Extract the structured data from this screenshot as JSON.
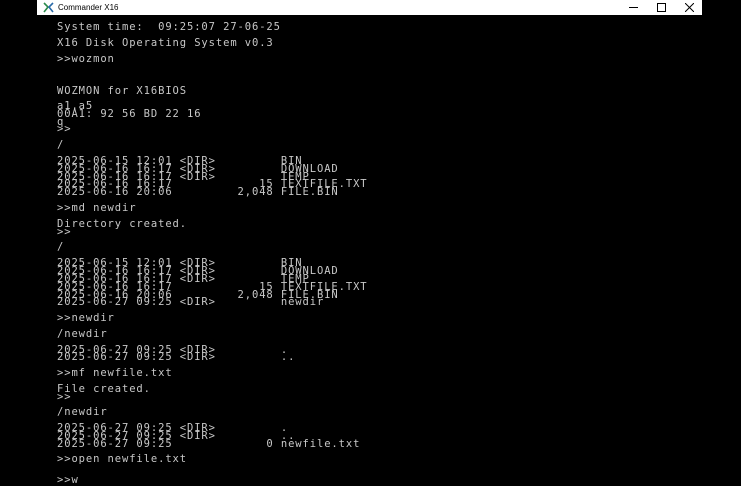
{
  "window": {
    "title": "Commander X16",
    "icon": "x16-logo-icon",
    "controls": [
      "minimize-icon",
      "maximize-icon",
      "close-icon"
    ]
  },
  "colors": {
    "background": "#000000",
    "text": "#c8c8c8",
    "titlebar": "#ffffff"
  },
  "terminal": {
    "lines": [
      "System time:  09:25:07 27-06-25",
      "X16 Disk Operating System v0.3",
      ">>wozmon",
      "WOZMON for X16BIOS",
      "a1.a5",
      "00A1: 92 56 BD 22 16",
      "q",
      ">>",
      "/",
      "2025-06-15 12:01 <DIR>         BIN",
      "2025-06-16 16:17 <DIR>         DOWNLOAD",
      "2025-06-16 16:17 <DIR>         TEMP",
      "2025-06-16 16:17            15 TEXTFILE.TXT",
      "2025-06-16 20:06         2,048 FILE.BIN",
      ">>md newdir",
      "Directory created.",
      ">>",
      "/",
      "2025-06-15 12:01 <DIR>         BIN",
      "2025-06-16 16:17 <DIR>         DOWNLOAD",
      "2025-06-16 16:17 <DIR>         TEMP",
      "2025-06-16 16:17            15 TEXTFILE.TXT",
      "2025-06-16 20:06         2,048 FILE.BIN",
      "2025-06-27 09:25 <DIR>         newdir",
      ">>newdir",
      "/newdir",
      "2025-06-27 09:25 <DIR>         .",
      "2025-06-27 09:25 <DIR>         ..",
      ">>mf newfile.txt",
      "File created.",
      ">>",
      "/newdir",
      "2025-06-27 09:25 <DIR>         .",
      "2025-06-27 09:25 <DIR>         ..",
      "2025-06-27 09:25             0 newfile.txt",
      ">>open newfile.txt",
      ">>w"
    ]
  }
}
